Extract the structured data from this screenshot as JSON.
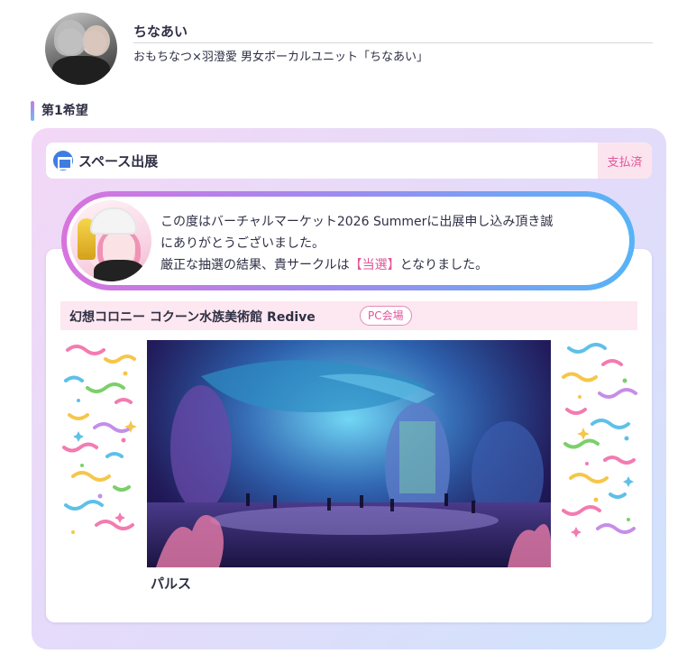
{
  "profile": {
    "circle_name": "ちなあい",
    "description": "おもちなつ×羽澄愛 男女ボーカルユニット「ちなあい」"
  },
  "section": {
    "heading": "第1希望"
  },
  "space": {
    "label": "スペース出展",
    "status": "支払済"
  },
  "message": {
    "line1": "この度はバーチャルマーケット2026 Summerに出展申し込み頂き誠",
    "line2": "にありがとうございました。",
    "line3_prefix": "厳正な抽選の結果、貴サークルは",
    "result": "【当選】",
    "line3_suffix": "となりました。"
  },
  "event": {
    "world_title": "幻想コロニー コクーン水族美術館 Redive",
    "venue_tag": "PC会場",
    "avatar_name": "パルス"
  },
  "colors": {
    "accent_pink": "#e0559a",
    "accent_blue": "#3f7de0",
    "text": "#2f3045"
  }
}
